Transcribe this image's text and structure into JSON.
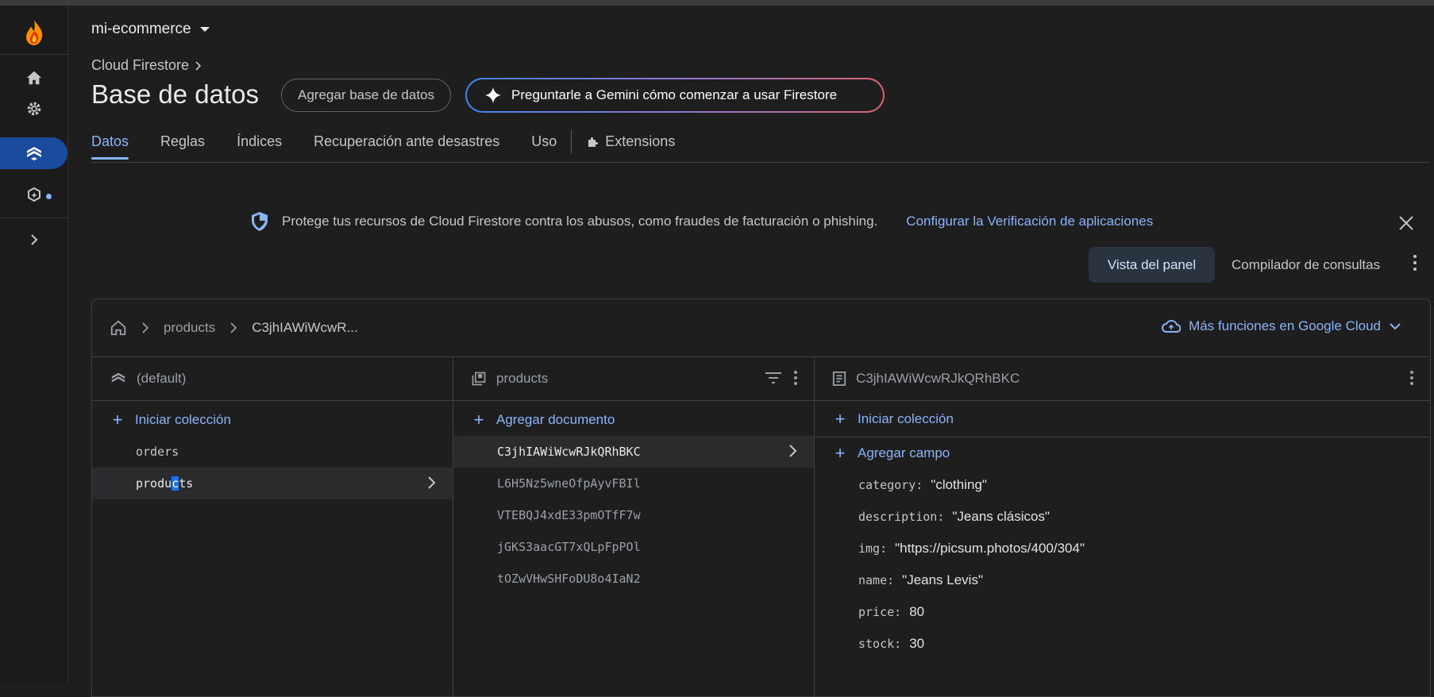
{
  "project": {
    "name": "mi-ecommerce"
  },
  "breadcrumb": {
    "parent": "Cloud Firestore"
  },
  "page": {
    "title": "Base de datos",
    "add_db_label": "Agregar base de datos",
    "gemini_label": "Preguntarle a Gemini cómo comenzar a usar Firestore"
  },
  "tabs": [
    {
      "label": "Datos",
      "active": true
    },
    {
      "label": "Reglas"
    },
    {
      "label": "Índices"
    },
    {
      "label": "Recuperación ante desastres"
    },
    {
      "label": "Uso"
    },
    {
      "label": "Extensions"
    }
  ],
  "banner": {
    "text": "Protege tus recursos de Cloud Firestore contra los abusos, como fraudes de facturación o phishing.",
    "link": "Configurar la Verificación de aplicaciones"
  },
  "view": {
    "panel_label": "Vista del panel",
    "query_label": "Compilador de consultas"
  },
  "data_panel": {
    "crumbs": [
      "products",
      "C3jhIAWiWcwR..."
    ],
    "gcloud_label": "Más funciones en Google Cloud",
    "col1": {
      "title": "(default)",
      "add_label": "Iniciar colección",
      "items": [
        "orders",
        "products"
      ],
      "selected_prefix": "produ",
      "selected_cursor": "c",
      "selected_suffix": "ts"
    },
    "col2": {
      "title": "products",
      "add_label": "Agregar documento",
      "items": [
        "C3jhIAWiWcwRJkQRhBKC",
        "L6H5Nz5wneOfpAyvFBIl",
        "VTEBQJ4xdE33pmOTfF7w",
        "jGKS3aacGT7xQLpFpPOl",
        "tOZwVHwSHFoDU8o4IaN2"
      ]
    },
    "col3": {
      "title": "C3jhIAWiWcwRJkQRhBKC",
      "add_collection_label": "Iniciar colección",
      "add_field_label": "Agregar campo",
      "fields": [
        {
          "key": "category:",
          "value": "\"clothing\""
        },
        {
          "key": "description:",
          "value": "\"Jeans clásicos\""
        },
        {
          "key": "img:",
          "value": "\"https://picsum.photos/400/304\""
        },
        {
          "key": "name:",
          "value": "\"Jeans Levis\""
        },
        {
          "key": "price:",
          "value": "80"
        },
        {
          "key": "stock:",
          "value": "30"
        }
      ]
    }
  },
  "colors": {
    "accent": "#8ab4f8",
    "active_rail": "#1a4b9c",
    "background": "#1e1e1f"
  }
}
